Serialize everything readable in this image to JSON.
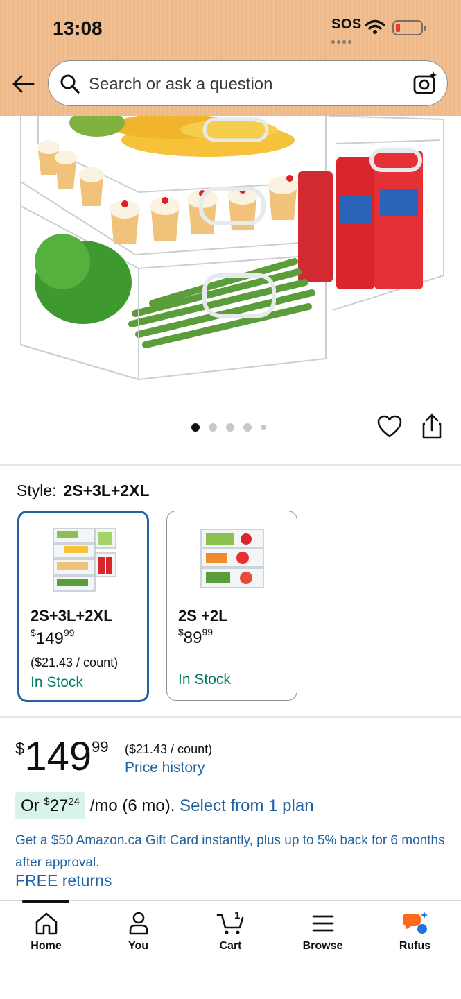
{
  "status_bar": {
    "time": "13:08",
    "carrier": "SOS"
  },
  "search": {
    "placeholder": "Search or ask a question"
  },
  "icons": {
    "back": "arrow-left-icon",
    "search": "magnifier-icon",
    "camera": "camera-sparkle-icon",
    "favorite": "heart-icon",
    "share": "share-icon",
    "home": "home-icon",
    "you": "person-icon",
    "cart": "cart-icon",
    "browse": "menu-icon",
    "rufus": "rufus-icon"
  },
  "gallery": {
    "total_images": 5,
    "active_index": 0
  },
  "style": {
    "label": "Style:",
    "selected_value": "2S+3L+2XL",
    "options": [
      {
        "name": "2S+3L+2XL",
        "price_whole": "149",
        "price_cents": "99",
        "price_symbol": "$",
        "unit_price": "($21.43 / count)",
        "stock": "In Stock",
        "selected": true
      },
      {
        "name": "2S +2L",
        "price_whole": "89",
        "price_cents": "99",
        "price_symbol": "$",
        "unit_price": "",
        "stock": "In Stock",
        "selected": false
      }
    ]
  },
  "price": {
    "symbol": "$",
    "whole": "149",
    "cents": "99",
    "unit_price": "($21.43 / count)",
    "history_link": "Price history"
  },
  "installments": {
    "prefix": "Or",
    "symbol": "$",
    "amount_whole": "27",
    "amount_cents": "24",
    "suffix": "/mo (6 mo).",
    "plan_link": "Select from 1 plan"
  },
  "promo": {
    "gift_card_text": "Get a $50 Amazon.ca Gift Card instantly, plus up to 5% back for 6 months after approval.",
    "free_returns": "FREE returns"
  },
  "bottom_nav": {
    "items": [
      {
        "label": "Home",
        "active": true
      },
      {
        "label": "You"
      },
      {
        "label": "Cart",
        "count": "1"
      },
      {
        "label": "Browse"
      },
      {
        "label": "Rufus"
      }
    ]
  },
  "colors": {
    "header_bg": "#eeb889",
    "link": "#2162a1",
    "in_stock": "#067d62",
    "selected_border": "#2162a1",
    "installment_pill": "#d8f3e9",
    "rufus_orange": "#ff6a1a",
    "rufus_blue": "#1a73e8"
  }
}
